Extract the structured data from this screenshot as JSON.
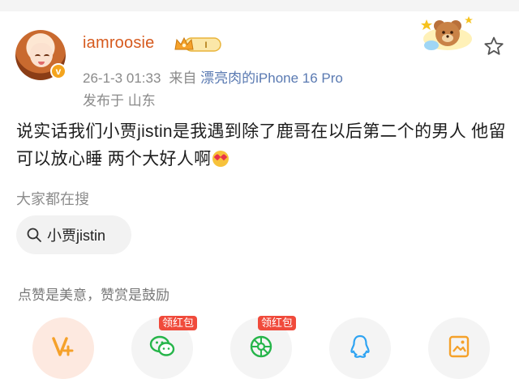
{
  "post": {
    "username": "iamroosie",
    "member_level": "I",
    "timestamp": "26-1-3 01:33",
    "source_prefix": "来自",
    "source_device": "漂亮肉的iPhone 16 Pro",
    "location": "发布于 山东",
    "text": "说实话我们小贾jistin是我遇到除了鹿哥在以后第二个的男人 他留可以放心睡 两个大好人啊"
  },
  "search": {
    "heading": "大家都在搜",
    "chip_label": "小贾jistin"
  },
  "reward": {
    "tip": "点赞是美意，赞赏是鼓励",
    "tags": [
      "领红包",
      "领红包"
    ]
  },
  "colors": {
    "username": "#d65a1e",
    "link": "#5a7ab2",
    "red_tag": "#f04a3b",
    "wechat_green": "#26b54a",
    "qq_blue": "#2ea3f2",
    "accent_orange": "#f5a12a"
  },
  "icons": [
    "verified-badge-icon",
    "member-crown-icon",
    "star-icon",
    "search-icon",
    "reward-v-icon",
    "wechat-icon",
    "moments-icon",
    "qq-icon",
    "image-share-icon",
    "heart-eyes-emoji"
  ]
}
